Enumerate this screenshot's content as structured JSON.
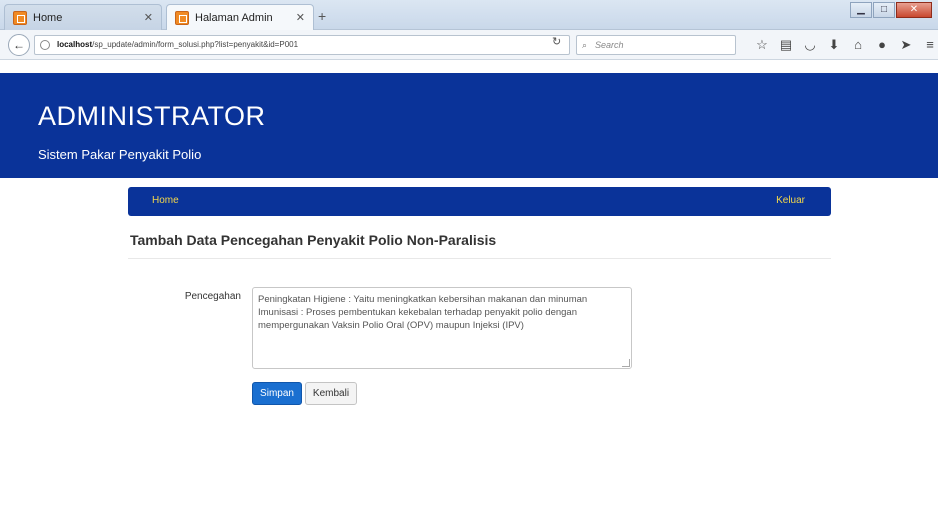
{
  "browser": {
    "tabs": [
      {
        "label": "Home",
        "active": false
      },
      {
        "label": "Halaman Admin",
        "active": true
      }
    ],
    "url_host": "localhost",
    "url_path": "/sp_update/admin/form_solusi.php?list=penyakit&id=P001",
    "search_placeholder": "Search",
    "toolbar_icons": [
      "star-icon",
      "reading-list-icon",
      "pocket-icon",
      "download-icon",
      "home-icon",
      "chat-icon",
      "send-icon",
      "menu-icon"
    ]
  },
  "header": {
    "title": "ADMINISTRATOR",
    "subtitle": "Sistem Pakar Penyakit Polio"
  },
  "menu": {
    "home_label": "Home",
    "logout_label": "Keluar"
  },
  "form": {
    "heading": "Tambah Data Pencegahan Penyakit Polio Non-Paralisis",
    "field_label": "Pencegahan",
    "field_value": "Peningkatan Higiene : Yaitu meningkatkan kebersihan makanan dan minuman\nImunisasi : Proses pembentukan kekebalan terhadap penyakit polio dengan\nmempergunakan Vaksin Polio Oral (OPV) maupun Injeksi (IPV)",
    "save_label": "Simpan",
    "back_label": "Kembali"
  },
  "colors": {
    "brand_blue": "#0a3399",
    "menu_link": "#f5d84a",
    "primary_button": "#1a6fd0"
  }
}
